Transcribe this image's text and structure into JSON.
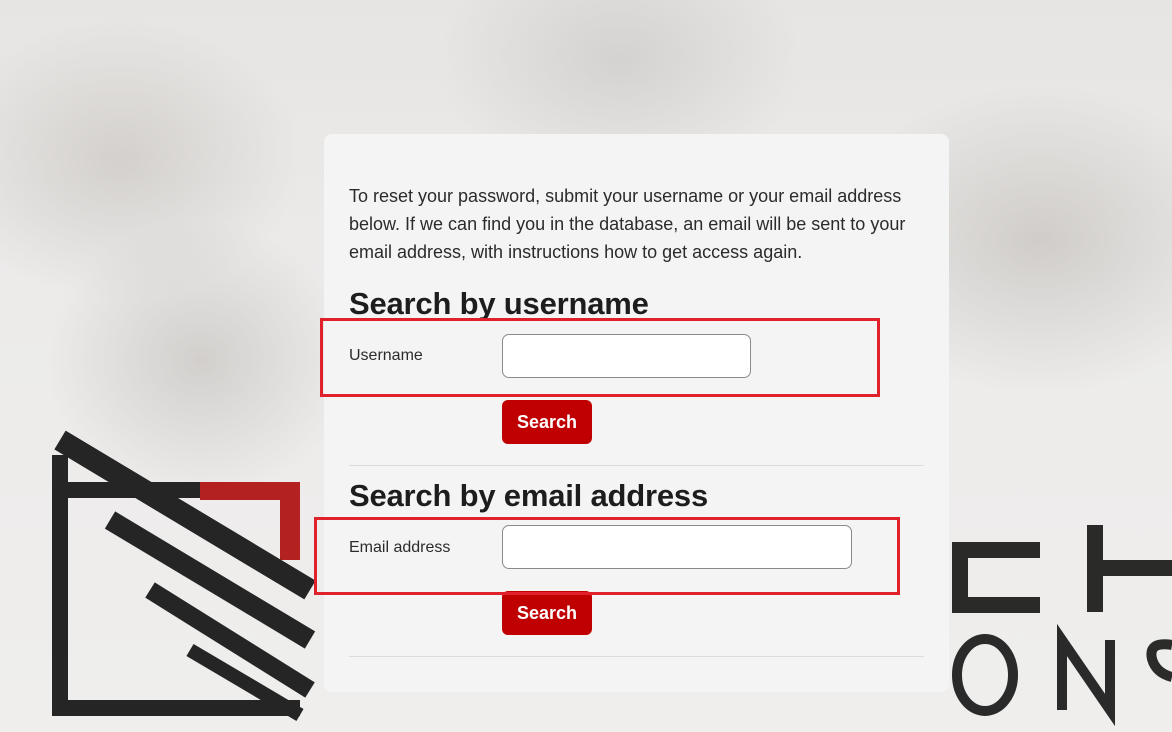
{
  "colors": {
    "accent": "#c00000",
    "highlight": "#e0202a",
    "card_background": "#f4f4f4"
  },
  "intro_text": "To reset your password, submit your username or your email address below. If we can find you in the database, an email will be sent to your email address, with instructions how to get access again.",
  "username_section": {
    "title": "Search by username",
    "field_label": "Username",
    "input_value": "",
    "button_label": "Search"
  },
  "email_section": {
    "title": "Search by email address",
    "field_label": "Email address",
    "input_value": "",
    "button_label": "Search"
  }
}
